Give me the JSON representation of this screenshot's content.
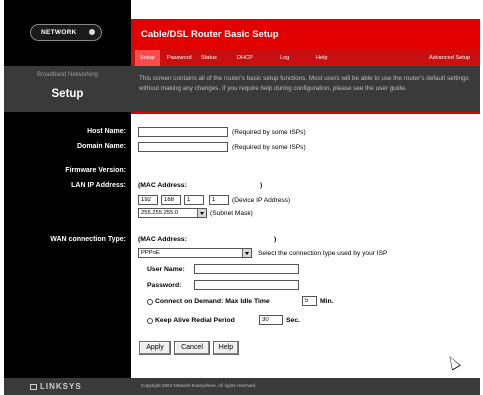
{
  "header": {
    "logo_text": "NETWORK",
    "title": "Cable/DSL Router Basic Setup",
    "tabs": [
      {
        "label": "Setup",
        "active": true
      },
      {
        "label": "Password"
      },
      {
        "label": "Status"
      },
      {
        "label": "DHCP"
      },
      {
        "label": "Log"
      },
      {
        "label": "Help"
      },
      {
        "label": "Advanced Setup"
      }
    ]
  },
  "sidebar": {
    "category": "Broadband Networking",
    "section_title": "Setup",
    "labels": {
      "host_name": "Host Name:",
      "domain_name": "Domain Name:",
      "firmware_version": "Firmware Version:",
      "lan_ip": "LAN IP Address:",
      "wan_type": "WAN connection Type:"
    },
    "brand": "LINKSYS"
  },
  "description": "This screen contains all of the router's basic setup functions. Most users will be able to use the router's default settings without making any changes. If you require help during configuration, please see the user guide.",
  "form": {
    "host_name": {
      "value": "",
      "hint": "(Required by some ISPs)"
    },
    "domain_name": {
      "value": "",
      "hint": "(Required by some ISPs)"
    },
    "firmware_version": "",
    "lan": {
      "mac_label": "(MAC Address:",
      "mac_close": ")",
      "ip_octets": [
        "192",
        "168",
        "1",
        "1"
      ],
      "ip_hint": "(Device IP Address)",
      "subnet": "255.255.255.0",
      "subnet_hint": "(Subnet Mask)"
    },
    "wan": {
      "mac_label": "(MAC Address:",
      "mac_close": ")",
      "type": "PPPoE",
      "type_hint": "Select the connection type used by your ISP",
      "user_name_label": "User Name:",
      "user_name": "",
      "password_label": "Password:",
      "password": "",
      "connect_on_demand_label": "Connect on Demand: Max Idle Time",
      "max_idle_time": "5",
      "min_label": "Min.",
      "keep_alive_label": "Keep Alive Redial Period",
      "redial_period": "30",
      "sec_label": "Sec."
    },
    "buttons": {
      "apply": "Apply",
      "cancel": "Cancel",
      "help": "Help"
    }
  },
  "footer": {
    "copyright": "Copyright 2002 Network Everywhere. All rights reserved."
  },
  "colors": {
    "brand_red": "#e20000",
    "dark_gray": "#3a3a3a",
    "black": "#000000"
  }
}
